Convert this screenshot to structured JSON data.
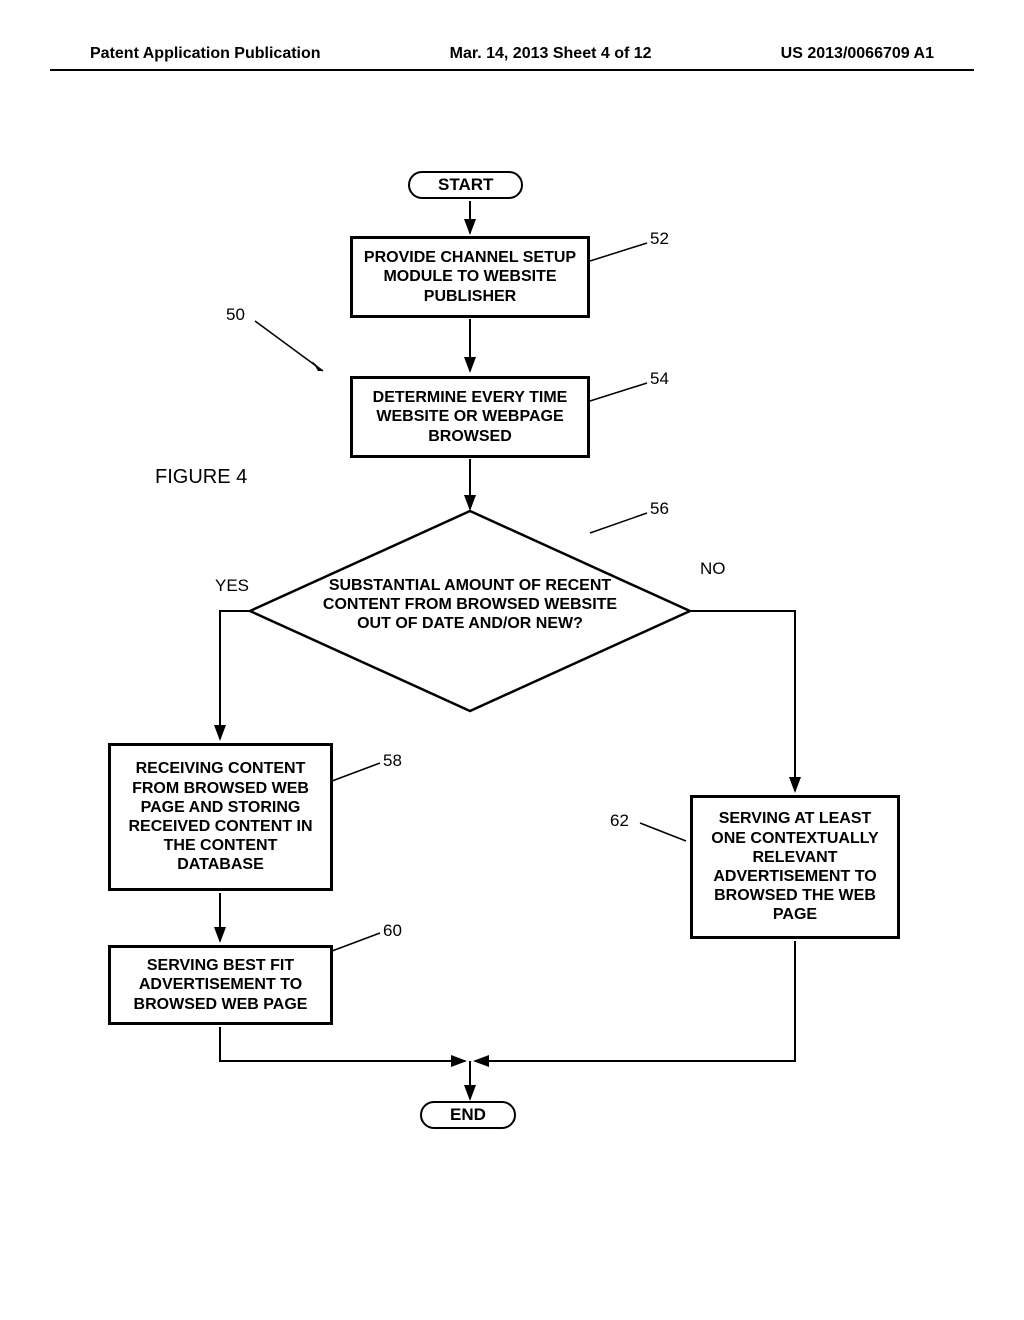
{
  "header": {
    "left": "Patent Application Publication",
    "mid": "Mar. 14, 2013  Sheet 4 of 12",
    "right": "US 2013/0066709 A1"
  },
  "figure_label": "FIGURE 4",
  "refs": {
    "r50": "50",
    "r52": "52",
    "r54": "54",
    "r56": "56",
    "r58": "58",
    "r60": "60",
    "r62": "62"
  },
  "nodes": {
    "start": "START",
    "n52": "PROVIDE CHANNEL SETUP MODULE TO WEBSITE PUBLISHER",
    "n54": "DETERMINE EVERY TIME WEBSITE OR WEBPAGE BROWSED",
    "decision": "SUBSTANTIAL AMOUNT OF RECENT CONTENT FROM BROWSED WEBSITE OUT OF DATE AND/OR NEW?",
    "yes": "YES",
    "no": "NO",
    "n58": "RECEIVING CONTENT FROM BROWSED WEB PAGE AND STORING RECEIVED CONTENT IN THE CONTENT DATABASE",
    "n60": "SERVING BEST FIT ADVERTISEMENT TO BROWSED WEB PAGE",
    "n62": "SERVING AT LEAST ONE CONTEXTUALLY RELEVANT ADVERTISEMENT TO BROWSED THE WEB PAGE",
    "end": "END"
  }
}
